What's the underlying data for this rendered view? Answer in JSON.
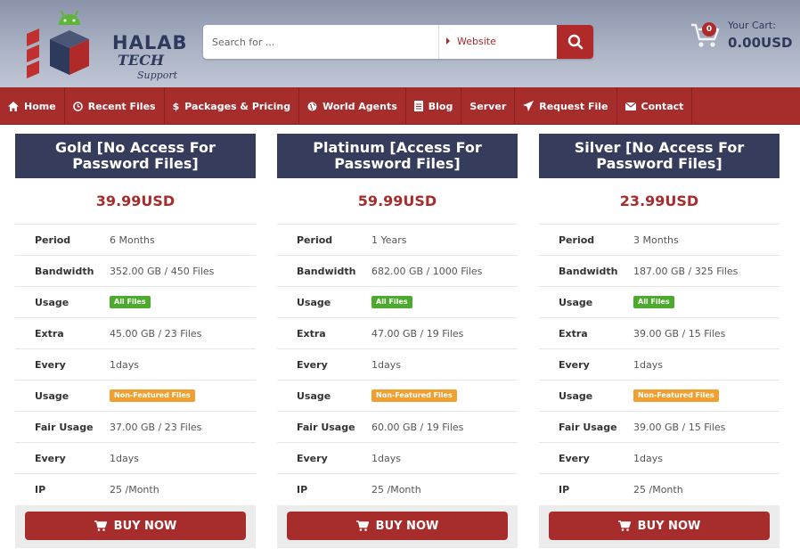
{
  "brand": {
    "line1": "HALAB",
    "line2": "TECH",
    "line3": "Support",
    "accent": "#a72c2c",
    "navy": "#363d5c"
  },
  "search": {
    "placeholder": "Search for ...",
    "scope": "Website"
  },
  "cart": {
    "label": "Your Cart:",
    "count": "0",
    "total": "0.00USD"
  },
  "nav": [
    {
      "label": "Home",
      "icon": "home-icon"
    },
    {
      "label": "Recent Files",
      "icon": "clock-icon"
    },
    {
      "label": "Packages & Pricing",
      "icon": "dollar-icon"
    },
    {
      "label": "World Agents",
      "icon": "globe-icon"
    },
    {
      "label": "Blog",
      "icon": "document-icon"
    },
    {
      "label": "Server",
      "icon": ""
    },
    {
      "label": "Request File",
      "icon": "send-icon"
    },
    {
      "label": "Contact",
      "icon": "envelope-icon"
    }
  ],
  "buy_label": "BUY NOW",
  "plans": [
    {
      "title": "Gold [No Access For Password Files]",
      "price": "39.99USD",
      "rows": [
        {
          "label": "Period",
          "value": "6 Months"
        },
        {
          "label": "Bandwidth",
          "value": "352.00 GB / 450 Files"
        },
        {
          "label": "Usage",
          "badge": "All Files",
          "badge_color": "green"
        },
        {
          "label": "Extra",
          "value": "45.00 GB / 23 Files"
        },
        {
          "label": "Every",
          "value": "1days"
        },
        {
          "label": "Usage",
          "badge": "Non-Featured Files",
          "badge_color": "orange"
        },
        {
          "label": "Fair Usage",
          "value": "37.00 GB / 23 Files"
        },
        {
          "label": "Every",
          "value": "1days"
        },
        {
          "label": "IP",
          "value": "25 /Month"
        }
      ]
    },
    {
      "title": "Platinum [Access For Password Files]",
      "price": "59.99USD",
      "rows": [
        {
          "label": "Period",
          "value": "1 Years"
        },
        {
          "label": "Bandwidth",
          "value": "682.00 GB / 1000 Files"
        },
        {
          "label": "Usage",
          "badge": "All Files",
          "badge_color": "green"
        },
        {
          "label": "Extra",
          "value": "47.00 GB / 19 Files"
        },
        {
          "label": "Every",
          "value": "1days"
        },
        {
          "label": "Usage",
          "badge": "Non-Featured Files",
          "badge_color": "orange"
        },
        {
          "label": "Fair Usage",
          "value": "60.00 GB / 19 Files"
        },
        {
          "label": "Every",
          "value": "1days"
        },
        {
          "label": "IP",
          "value": "25 /Month"
        }
      ]
    },
    {
      "title": "Silver [No Access For Password Files]",
      "price": "23.99USD",
      "rows": [
        {
          "label": "Period",
          "value": "3 Months"
        },
        {
          "label": "Bandwidth",
          "value": "187.00 GB / 325 Files"
        },
        {
          "label": "Usage",
          "badge": "All Files",
          "badge_color": "green"
        },
        {
          "label": "Extra",
          "value": "39.00 GB / 15 Files"
        },
        {
          "label": "Every",
          "value": "1days"
        },
        {
          "label": "Usage",
          "badge": "Non-Featured Files",
          "badge_color": "orange"
        },
        {
          "label": "Fair Usage",
          "value": "39.00 GB / 15 Files"
        },
        {
          "label": "Every",
          "value": "1days"
        },
        {
          "label": "IP",
          "value": "25 /Month"
        }
      ]
    }
  ]
}
